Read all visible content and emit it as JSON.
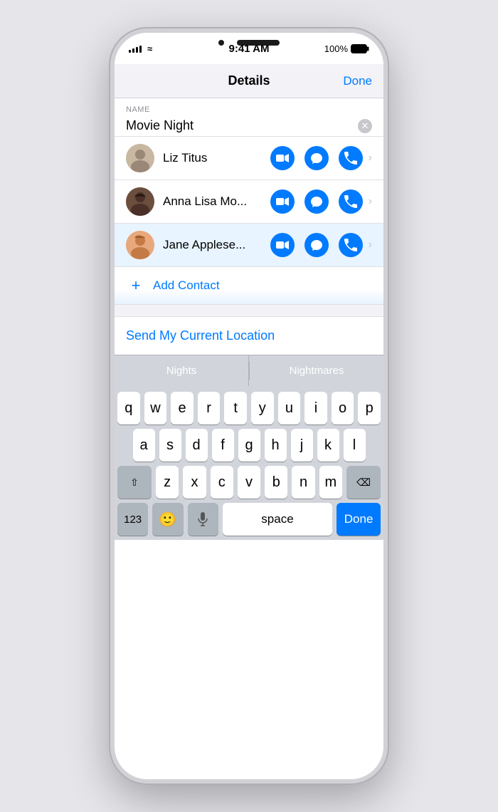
{
  "status_bar": {
    "time": "9:41 AM",
    "battery": "100%",
    "signal_bars": [
      4,
      6,
      8,
      10,
      12
    ]
  },
  "nav": {
    "title": "Details",
    "done_label": "Done"
  },
  "name_section": {
    "label": "NAME",
    "value": "Movie Night",
    "clear_title": "clear"
  },
  "contacts": [
    {
      "name": "Liz Titus",
      "avatar": "🧑",
      "avatar_bg": "#c8b8a2"
    },
    {
      "name": "Anna Lisa Mo...",
      "avatar": "👩",
      "avatar_bg": "#6b4e3d"
    },
    {
      "name": "Jane Applese...",
      "avatar": "👩",
      "avatar_bg": "#e8a87c"
    }
  ],
  "add_contact": {
    "label": "Add Contact",
    "icon": "+"
  },
  "send_location": {
    "label": "Send My Current Location"
  },
  "autocomplete": {
    "suggestions": [
      "Nights",
      "Nightmares"
    ]
  },
  "keyboard": {
    "rows": [
      [
        "q",
        "w",
        "e",
        "r",
        "t",
        "y",
        "u",
        "i",
        "o",
        "p"
      ],
      [
        "a",
        "s",
        "d",
        "f",
        "g",
        "h",
        "j",
        "k",
        "l"
      ],
      [
        "z",
        "x",
        "c",
        "v",
        "b",
        "n",
        "m"
      ]
    ],
    "bottom": {
      "numbers": "123",
      "space": "space",
      "done": "Done"
    }
  },
  "icons": {
    "video": "🎥",
    "message": "💬",
    "phone": "📞",
    "plus": "+",
    "shift": "⇧",
    "delete": "⌫",
    "emoji": "🙂",
    "mic": "🎤"
  }
}
